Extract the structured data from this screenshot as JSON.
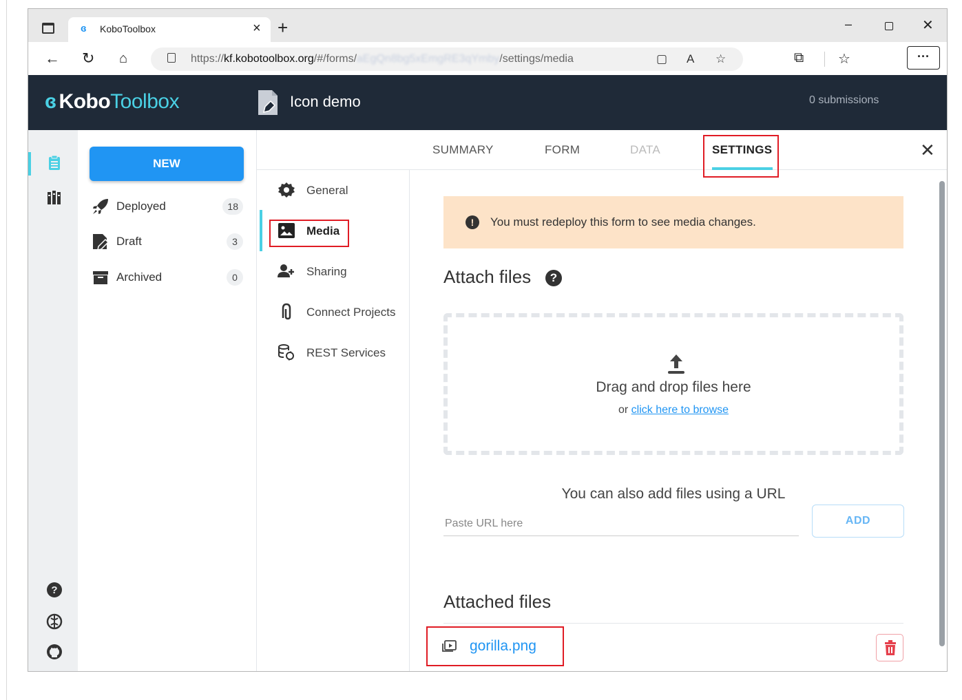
{
  "browser": {
    "tab_title": "KoboToolbox",
    "tab_close": "×",
    "new_tab": "+",
    "url_prefix": "https://",
    "url_host": "kf.kobotoolbox.org",
    "url_path1": "/#/forms/",
    "url_blurred": "aEgQn8bg5xEmgRE3qYmby",
    "url_path2": "/settings/media",
    "more_label": "···",
    "win_min": "–",
    "win_close": "✕"
  },
  "header": {
    "logo_kobo": "Kobo",
    "logo_toolbox": "Toolbox",
    "project_title": "Icon demo",
    "submissions": "0 submissions"
  },
  "drawer": {
    "new_label": "NEW",
    "items": [
      {
        "label": "Deployed",
        "count": "18"
      },
      {
        "label": "Draft",
        "count": "3"
      },
      {
        "label": "Archived",
        "count": "0"
      }
    ]
  },
  "tabs": {
    "summary": "SUMMARY",
    "form": "FORM",
    "data": "DATA",
    "settings": "SETTINGS",
    "close": "✕"
  },
  "subnav": {
    "general": "General",
    "media": "Media",
    "sharing": "Sharing",
    "connect": "Connect Projects",
    "rest": "REST Services"
  },
  "content": {
    "alert_text": "You must redeploy this form to see media changes.",
    "attach_title": "Attach files",
    "dropzone_text": "Drag and drop files here",
    "dropzone_or": "or ",
    "dropzone_link": "click here to browse",
    "url_hint": "You can also add files using a URL",
    "url_placeholder": "Paste URL here",
    "add_label": "ADD",
    "attached_title": "Attached files",
    "files": [
      {
        "name": "gorilla.png"
      }
    ]
  },
  "colors": {
    "accent": "#4ad0e4",
    "primary": "#2095f3",
    "header_bg": "#1f2a38",
    "alert_bg": "#fde3c8",
    "highlight": "#e01b24"
  }
}
